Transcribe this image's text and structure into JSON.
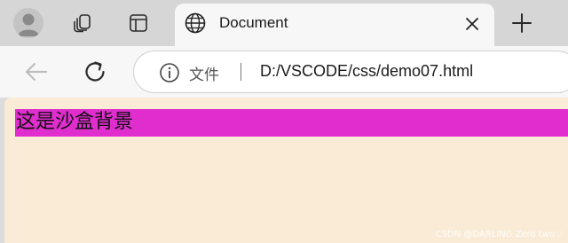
{
  "tab": {
    "title": "Document"
  },
  "address_bar": {
    "site_label": "文件",
    "url": "D:/VSCODE/css/demo07.html"
  },
  "content": {
    "sandbox_text": "这是沙盒背景",
    "watermark": "CSDN @DARLING Zero two♡"
  },
  "colors": {
    "page_background": "#faebd7",
    "div_background": "#e02dcd"
  },
  "icons": {
    "profile": "avatar",
    "workspaces": "tab-groups-icon",
    "vertical_tabs": "tab-actions-icon",
    "tab_favicon": "globe-icon",
    "tab_close": "close-icon",
    "new_tab": "plus-icon",
    "back": "back-arrow-icon",
    "reload": "reload-icon",
    "site_info": "info-icon"
  }
}
